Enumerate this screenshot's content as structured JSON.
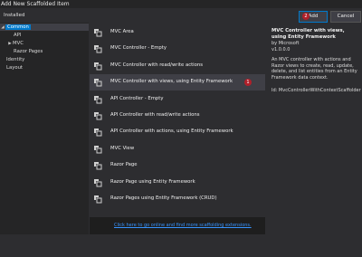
{
  "window": {
    "title": "Add New Scaffolded Item"
  },
  "left_panel": {
    "header": "Installed",
    "tree": [
      {
        "label": "Common",
        "expanded": true,
        "selected": true
      },
      {
        "label": "API"
      },
      {
        "label": "MVC",
        "collapsed": true
      },
      {
        "label": "Razor Pages"
      },
      {
        "label": "Identity"
      },
      {
        "label": "Layout"
      }
    ]
  },
  "templates": [
    {
      "label": "MVC Area"
    },
    {
      "label": "MVC Controller - Empty"
    },
    {
      "label": "MVC Controller with read/write actions"
    },
    {
      "label": "MVC Controller with views, using Entity Framework",
      "selected": true,
      "badge": "1"
    },
    {
      "label": "API Controller - Empty"
    },
    {
      "label": "API Controller with read/write actions"
    },
    {
      "label": "API Controller with actions, using Entity Framework"
    },
    {
      "label": "MVC View"
    },
    {
      "label": "Razor Page"
    },
    {
      "label": "Razor Page using Entity Framework"
    },
    {
      "label": "Razor Pages using Entity Framework (CRUD)"
    }
  ],
  "details": {
    "title": "MVC Controller with views, using Entity Framework",
    "by": "by Microsoft",
    "version": "v1.0.0.0",
    "description": "An MVC controller with actions and Razor views to create, read, update, delete, and list entities from an Entity Framework data context.",
    "id": "Id: MvcControllerWithContextScaffolder"
  },
  "online_link": "Click here to go online and find more scaffolding extensions.",
  "buttons": {
    "add": "Add",
    "cancel": "Cancel",
    "add_badge": "2"
  },
  "colors": {
    "accent": "#007acc",
    "badge": "#b0202a",
    "link": "#3794ff"
  },
  "icons": {
    "template": "scaffold-template-icon"
  }
}
